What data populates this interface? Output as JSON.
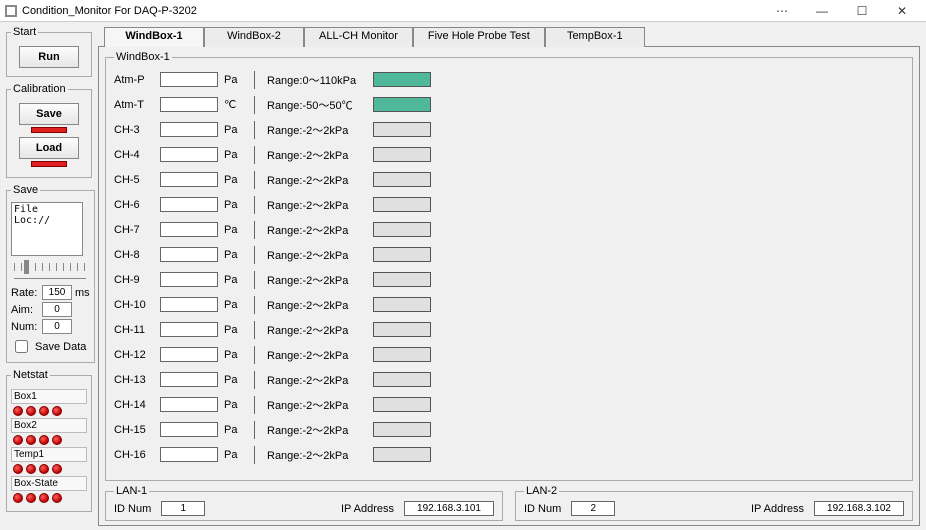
{
  "window": {
    "title": "Condition_Monitor For DAQ-P-3202"
  },
  "sidebar": {
    "start": {
      "legend": "Start",
      "run_label": "Run"
    },
    "calibration": {
      "legend": "Calibration",
      "save_label": "Save",
      "load_label": "Load"
    },
    "save": {
      "legend": "Save",
      "file_loc_text": "File Loc://",
      "rate_label": "Rate:",
      "rate_value": "150",
      "rate_unit": "ms",
      "aim_label": "Aim:",
      "aim_value": "0",
      "num_label": "Num:",
      "num_value": "0",
      "save_data_label": "Save Data"
    },
    "netstat": {
      "legend": "Netstat",
      "rows": [
        {
          "label": "Box1",
          "leds": 4
        },
        {
          "label": "Box2",
          "leds": 4
        },
        {
          "label": "Temp1",
          "leds": 4
        },
        {
          "label": "Box-State",
          "leds": 4
        }
      ]
    }
  },
  "tabs": [
    {
      "label": "WindBox-1",
      "active": true
    },
    {
      "label": "WindBox-2",
      "active": false
    },
    {
      "label": "ALL-CH Monitor",
      "active": false
    },
    {
      "label": "Five Hole Probe Test",
      "active": false
    },
    {
      "label": "TempBox-1",
      "active": false
    }
  ],
  "windbox": {
    "legend": "WindBox-1",
    "channels": [
      {
        "name": "Atm-P",
        "value": "",
        "unit": "Pa",
        "range": "Range:0～110kPa",
        "ok": true
      },
      {
        "name": "Atm-T",
        "value": "",
        "unit": "℃",
        "range": "Range:-50～50℃",
        "ok": true
      },
      {
        "name": "CH-3",
        "value": "",
        "unit": "Pa",
        "range": "Range:-2～2kPa",
        "ok": false
      },
      {
        "name": "CH-4",
        "value": "",
        "unit": "Pa",
        "range": "Range:-2～2kPa",
        "ok": false
      },
      {
        "name": "CH-5",
        "value": "",
        "unit": "Pa",
        "range": "Range:-2～2kPa",
        "ok": false
      },
      {
        "name": "CH-6",
        "value": "",
        "unit": "Pa",
        "range": "Range:-2～2kPa",
        "ok": false
      },
      {
        "name": "CH-7",
        "value": "",
        "unit": "Pa",
        "range": "Range:-2～2kPa",
        "ok": false
      },
      {
        "name": "CH-8",
        "value": "",
        "unit": "Pa",
        "range": "Range:-2～2kPa",
        "ok": false
      },
      {
        "name": "CH-9",
        "value": "",
        "unit": "Pa",
        "range": "Range:-2～2kPa",
        "ok": false
      },
      {
        "name": "CH-10",
        "value": "",
        "unit": "Pa",
        "range": "Range:-2～2kPa",
        "ok": false
      },
      {
        "name": "CH-11",
        "value": "",
        "unit": "Pa",
        "range": "Range:-2～2kPa",
        "ok": false
      },
      {
        "name": "CH-12",
        "value": "",
        "unit": "Pa",
        "range": "Range:-2～2kPa",
        "ok": false
      },
      {
        "name": "CH-13",
        "value": "",
        "unit": "Pa",
        "range": "Range:-2～2kPa",
        "ok": false
      },
      {
        "name": "CH-14",
        "value": "",
        "unit": "Pa",
        "range": "Range:-2～2kPa",
        "ok": false
      },
      {
        "name": "CH-15",
        "value": "",
        "unit": "Pa",
        "range": "Range:-2～2kPa",
        "ok": false
      },
      {
        "name": "CH-16",
        "value": "",
        "unit": "Pa",
        "range": "Range:-2～2kPa",
        "ok": false
      }
    ]
  },
  "lan1": {
    "legend": "LAN-1",
    "id_label": "ID Num",
    "id_value": "1",
    "ip_label": "IP Address",
    "ip_value": "192.168.3.101"
  },
  "lan2": {
    "legend": "LAN-2",
    "id_label": "ID Num",
    "id_value": "2",
    "ip_label": "IP Address",
    "ip_value": "192.168.3.102"
  }
}
